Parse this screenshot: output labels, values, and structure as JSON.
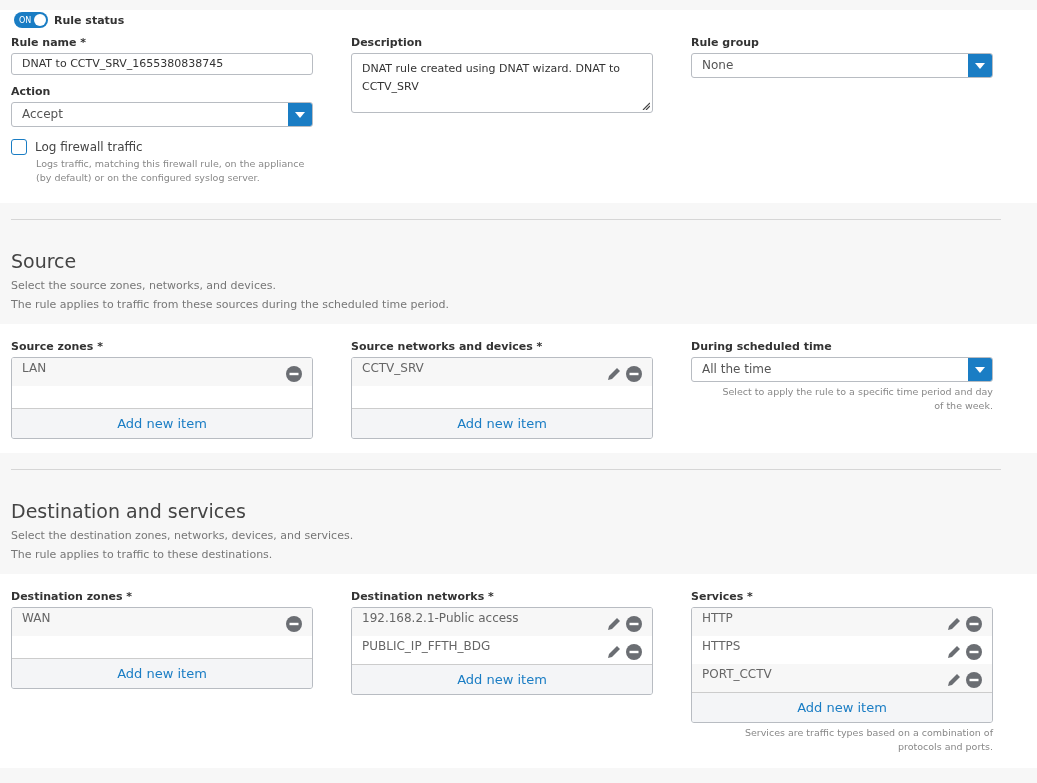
{
  "rule_status": {
    "toggle_text": "ON",
    "on": true,
    "label": "Rule status"
  },
  "general": {
    "rule_name": {
      "label": "Rule name *",
      "value": "DNAT to CCTV_SRV_1655380838745"
    },
    "action": {
      "label": "Action",
      "value": "Accept"
    },
    "log": {
      "label": "Log firewall traffic",
      "checked": false,
      "help": "Logs traffic, matching this firewall rule, on the appliance (by default) or on the configured syslog server."
    },
    "description": {
      "label": "Description",
      "value": "DNAT rule created using DNAT wizard. DNAT to CCTV_SRV"
    },
    "rule_group": {
      "label": "Rule group",
      "value": "None"
    }
  },
  "sections": [
    {
      "title": "Source",
      "lines": [
        "Select the source zones, networks, and devices.",
        "The rule applies to traffic from these sources during the scheduled time period."
      ],
      "fields": [
        {
          "kind": "list",
          "label": "Source zones *",
          "items": [
            {
              "name": "LAN",
              "editable": false
            }
          ],
          "add_label": "Add new item"
        },
        {
          "kind": "list",
          "label": "Source networks and devices *",
          "items": [
            {
              "name": "CCTV_SRV",
              "editable": true
            }
          ],
          "add_label": "Add new item"
        },
        {
          "kind": "select",
          "label": "During scheduled time",
          "value": "All the time",
          "help": "Select to apply the rule to a specific time period and day of the week."
        }
      ]
    },
    {
      "title": "Destination and services",
      "lines": [
        "Select the destination zones, networks, devices, and services.",
        "The rule applies to traffic to these destinations."
      ],
      "fields": [
        {
          "kind": "list",
          "label": "Destination zones *",
          "items": [
            {
              "name": "WAN",
              "editable": false
            }
          ],
          "add_label": "Add new item"
        },
        {
          "kind": "list",
          "label": "Destination networks *",
          "items": [
            {
              "name": "192.168.2.1-Public access",
              "editable": true
            },
            {
              "name": "PUBLIC_IP_FFTH_BDG",
              "editable": true
            }
          ],
          "add_label": "Add new item"
        },
        {
          "kind": "list",
          "label": "Services *",
          "items": [
            {
              "name": "HTTP",
              "editable": true
            },
            {
              "name": "HTTPS",
              "editable": true
            },
            {
              "name": "PORT_CCTV",
              "editable": true
            }
          ],
          "add_label": "Add new item",
          "help": "Services are traffic types based on a combination of protocols and ports."
        }
      ]
    }
  ]
}
